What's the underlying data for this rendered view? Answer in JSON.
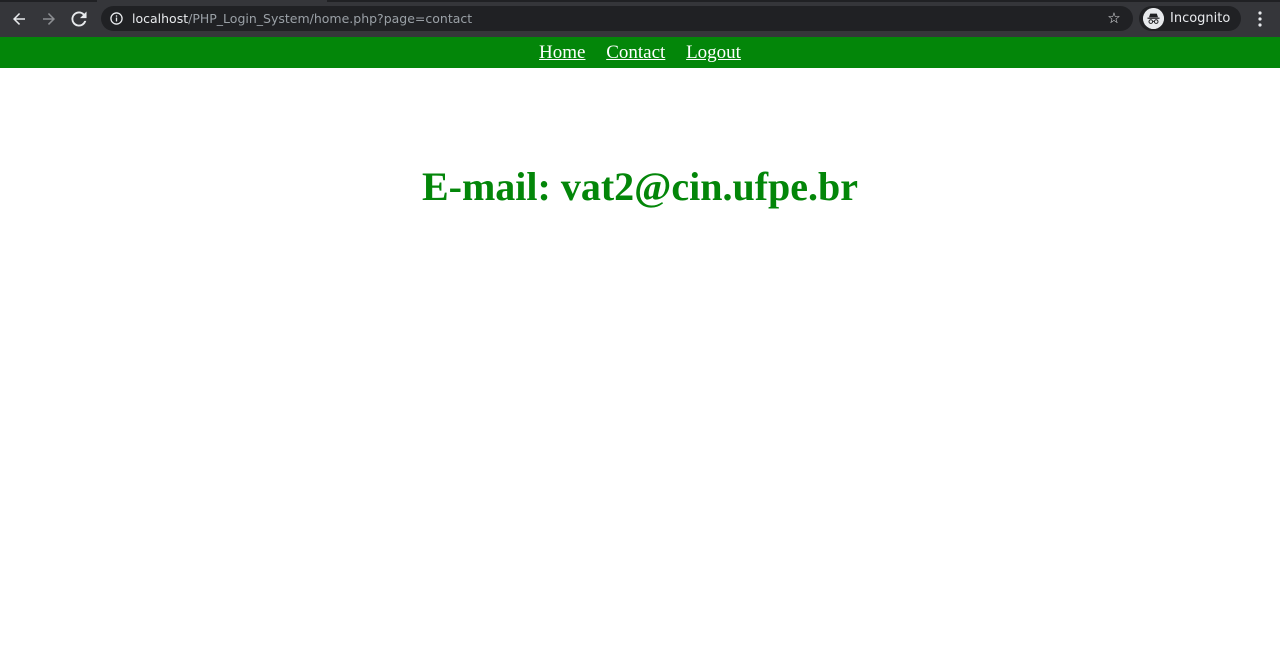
{
  "browser": {
    "url_host": "localhost",
    "url_path": "/PHP_Login_System/home.php?page=contact",
    "incognito_label": "Incognito",
    "icons": {
      "back": "back-arrow-icon",
      "forward": "forward-arrow-icon",
      "reload": "reload-icon",
      "site_info": "info-icon",
      "bookmark": "star-icon",
      "incognito": "incognito-icon",
      "menu": "kebab-menu-icon"
    }
  },
  "nav": {
    "background": "#038609",
    "links": {
      "home": "Home",
      "contact": "Contact",
      "logout": "Logout"
    }
  },
  "main": {
    "heading": "E-mail: vat2@cin.ufpe.br",
    "heading_color": "#038609"
  }
}
